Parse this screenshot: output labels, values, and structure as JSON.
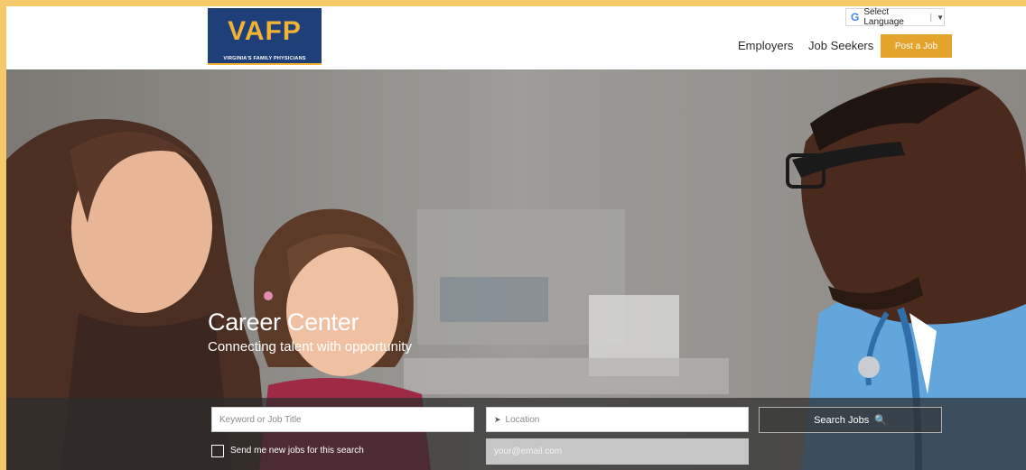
{
  "header": {
    "logo": {
      "main_text": "VAFP",
      "sub_text": "VIRGINIA'S FAMILY PHYSICIANS"
    },
    "language": {
      "icon": "google-g-icon",
      "label": "Select Language",
      "arrow": "▼"
    },
    "nav": {
      "employers": "Employers",
      "job_seekers": "Job Seekers",
      "post_job": "Post a Job"
    }
  },
  "hero": {
    "title": "Career Center",
    "subtitle": "Connecting talent with opportunity"
  },
  "search": {
    "keyword_placeholder": "Keyword or Job Title",
    "location_placeholder": "Location",
    "location_icon": "location-arrow-icon",
    "search_button": "Search Jobs",
    "search_icon": "search-icon",
    "alert_label": "Send me new jobs for this search",
    "email_placeholder": "your@email.com"
  },
  "colors": {
    "brand_navy": "#1f3f79",
    "brand_gold": "#f2b233",
    "post_job_button": "#e4a32b",
    "page_border": "#f5c96a"
  }
}
